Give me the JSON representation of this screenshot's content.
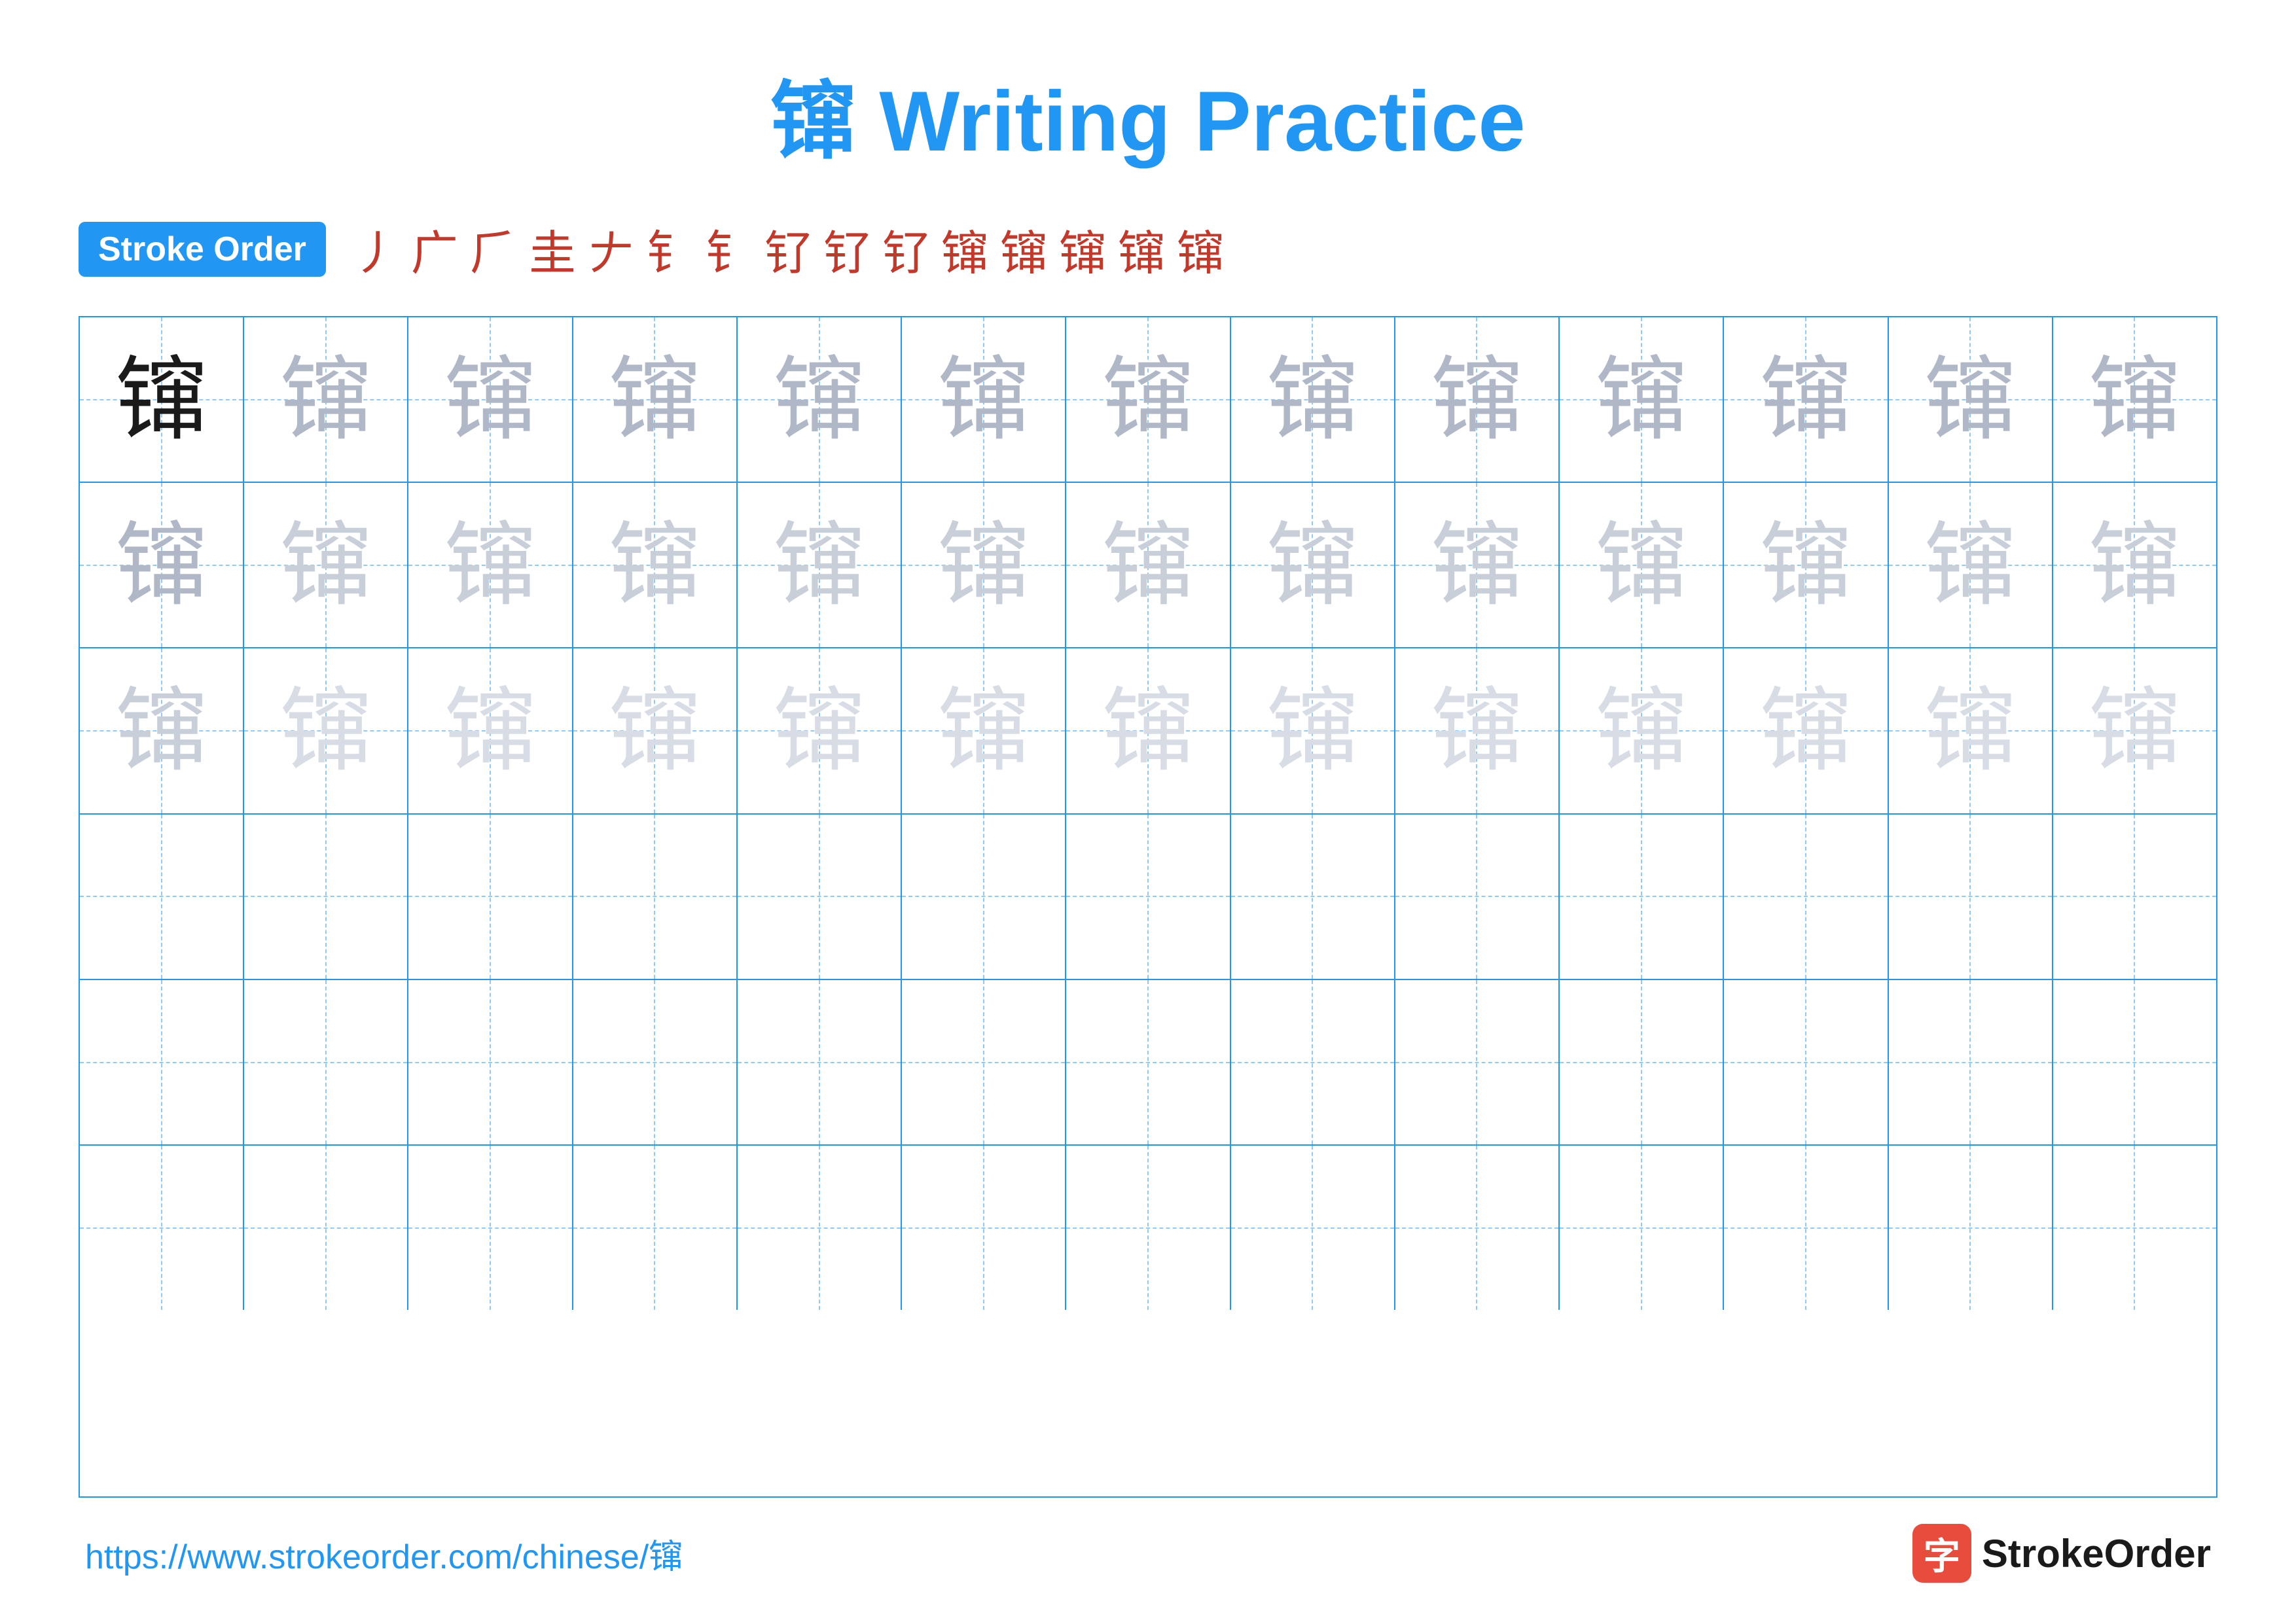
{
  "title": {
    "char": "镩",
    "label": "Writing Practice",
    "full": "镩 Writing Practice"
  },
  "stroke_order": {
    "badge_label": "Stroke Order",
    "strokes": [
      "丿",
      "广",
      "⺁",
      "生",
      "𠂇",
      "钅",
      "钅",
      "钉",
      "钉",
      "钉",
      "镩",
      "镩",
      "镩",
      "镩",
      "镩"
    ]
  },
  "grid": {
    "rows": 6,
    "cols": 13,
    "char": "镩"
  },
  "footer": {
    "url": "https://www.strokeorder.com/chinese/镩",
    "logo_text": "StrokeOrder",
    "logo_char": "字"
  }
}
